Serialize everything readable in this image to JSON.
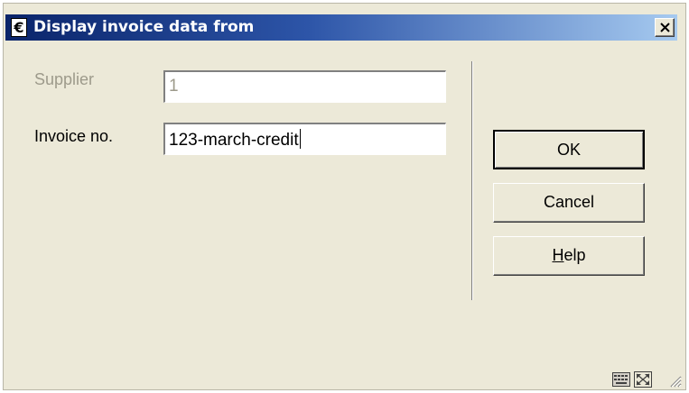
{
  "window": {
    "title": "Display invoice data from",
    "app_icon_glyph": "€",
    "title_gradient": [
      "#0a246a",
      "#a6caf0"
    ]
  },
  "form": {
    "supplier_label": "Supplier",
    "supplier_value": "1",
    "invoice_label": "Invoice no.",
    "invoice_value": "123-march-credit"
  },
  "buttons": {
    "ok_label": "OK",
    "cancel_label": "Cancel",
    "help_mnemonic": "H",
    "help_rest": "elp"
  },
  "icons": {
    "close": "close-icon",
    "status_1": "keyboard-icon",
    "status_2": "maximize-icon",
    "grip": "resize-grip-icon"
  }
}
